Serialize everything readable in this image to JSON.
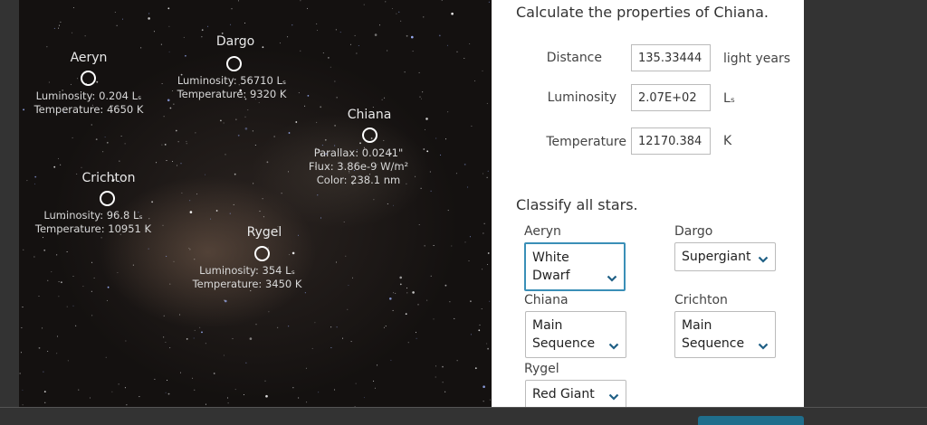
{
  "stars": {
    "aeryn": {
      "name": "Aeryn",
      "info1": "Luminosity: 0.204 Lₛ",
      "info2": "Temperature: 4650 K"
    },
    "dargo": {
      "name": "Dargo",
      "info1": "Luminosity: 56710 Lₛ",
      "info2": "Temperature: 9320 K"
    },
    "chiana": {
      "name": "Chiana",
      "info1": "Parallax: 0.0241\"",
      "info2": "Flux: 3.86e-9 W/m²",
      "info3": "Color: 238.1 nm"
    },
    "crichton": {
      "name": "Crichton",
      "info1": "Luminosity: 96.8 Lₛ",
      "info2": "Temperature: 10951 K"
    },
    "rygel": {
      "name": "Rygel",
      "info1": "Luminosity: 354 Lₛ",
      "info2": "Temperature: 3450 K"
    }
  },
  "properties": {
    "title": "Calculate the properties of Chiana.",
    "distance": {
      "label": "Distance",
      "value": "135.33444",
      "unit": "light years"
    },
    "luminosity": {
      "label": "Luminosity",
      "value": "2.07E+02",
      "unit": "Lₛ"
    },
    "temperature": {
      "label": "Temperature",
      "value": "12170.384",
      "unit": "K"
    }
  },
  "classify": {
    "title": "Classify all stars.",
    "aeryn": {
      "label": "Aeryn",
      "value": "White Dwarf"
    },
    "dargo": {
      "label": "Dargo",
      "value": "Supergiant"
    },
    "chiana": {
      "label": "Chiana",
      "value": "Main Sequence"
    },
    "crichton": {
      "label": "Crichton",
      "value": "Main Sequence"
    },
    "rygel": {
      "label": "Rygel",
      "value": "Red Giant"
    }
  },
  "colors": {
    "chevron": "#1f5f85",
    "focus_border": "#3a8fb7",
    "submit": "#1f6e8c"
  },
  "icons": {
    "dropdown": "chevron-down-icon"
  }
}
